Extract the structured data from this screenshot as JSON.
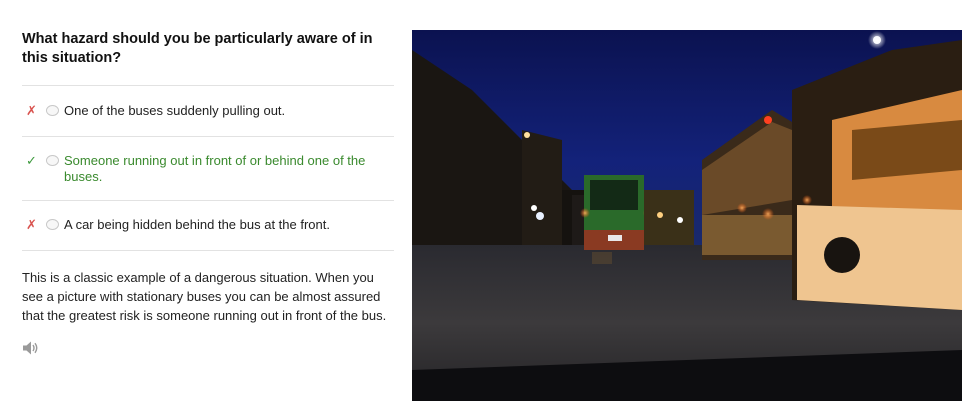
{
  "question": "What hazard should you be particularly aware of in this situation?",
  "options": [
    {
      "text": "One of the buses suddenly pulling out.",
      "result": "wrong",
      "mark": "✗"
    },
    {
      "text": "Someone running out in front of or behind one of the buses.",
      "result": "correct",
      "mark": "✓"
    },
    {
      "text": "A car being hidden behind the bus at the front.",
      "result": "wrong",
      "mark": "✗"
    }
  ],
  "explanation": "This is a classic example of a dangerous situation. When you see a picture with stationary buses you can be almost assured that the greatest risk is someone running out in front of the bus.",
  "audio_icon": "speaker-icon",
  "image": {
    "description_icon": "night-street-with-buses-photo"
  },
  "colors": {
    "wrong": "#d9534f",
    "correct": "#3d9a3d",
    "correct_text": "#3a8a2e"
  }
}
